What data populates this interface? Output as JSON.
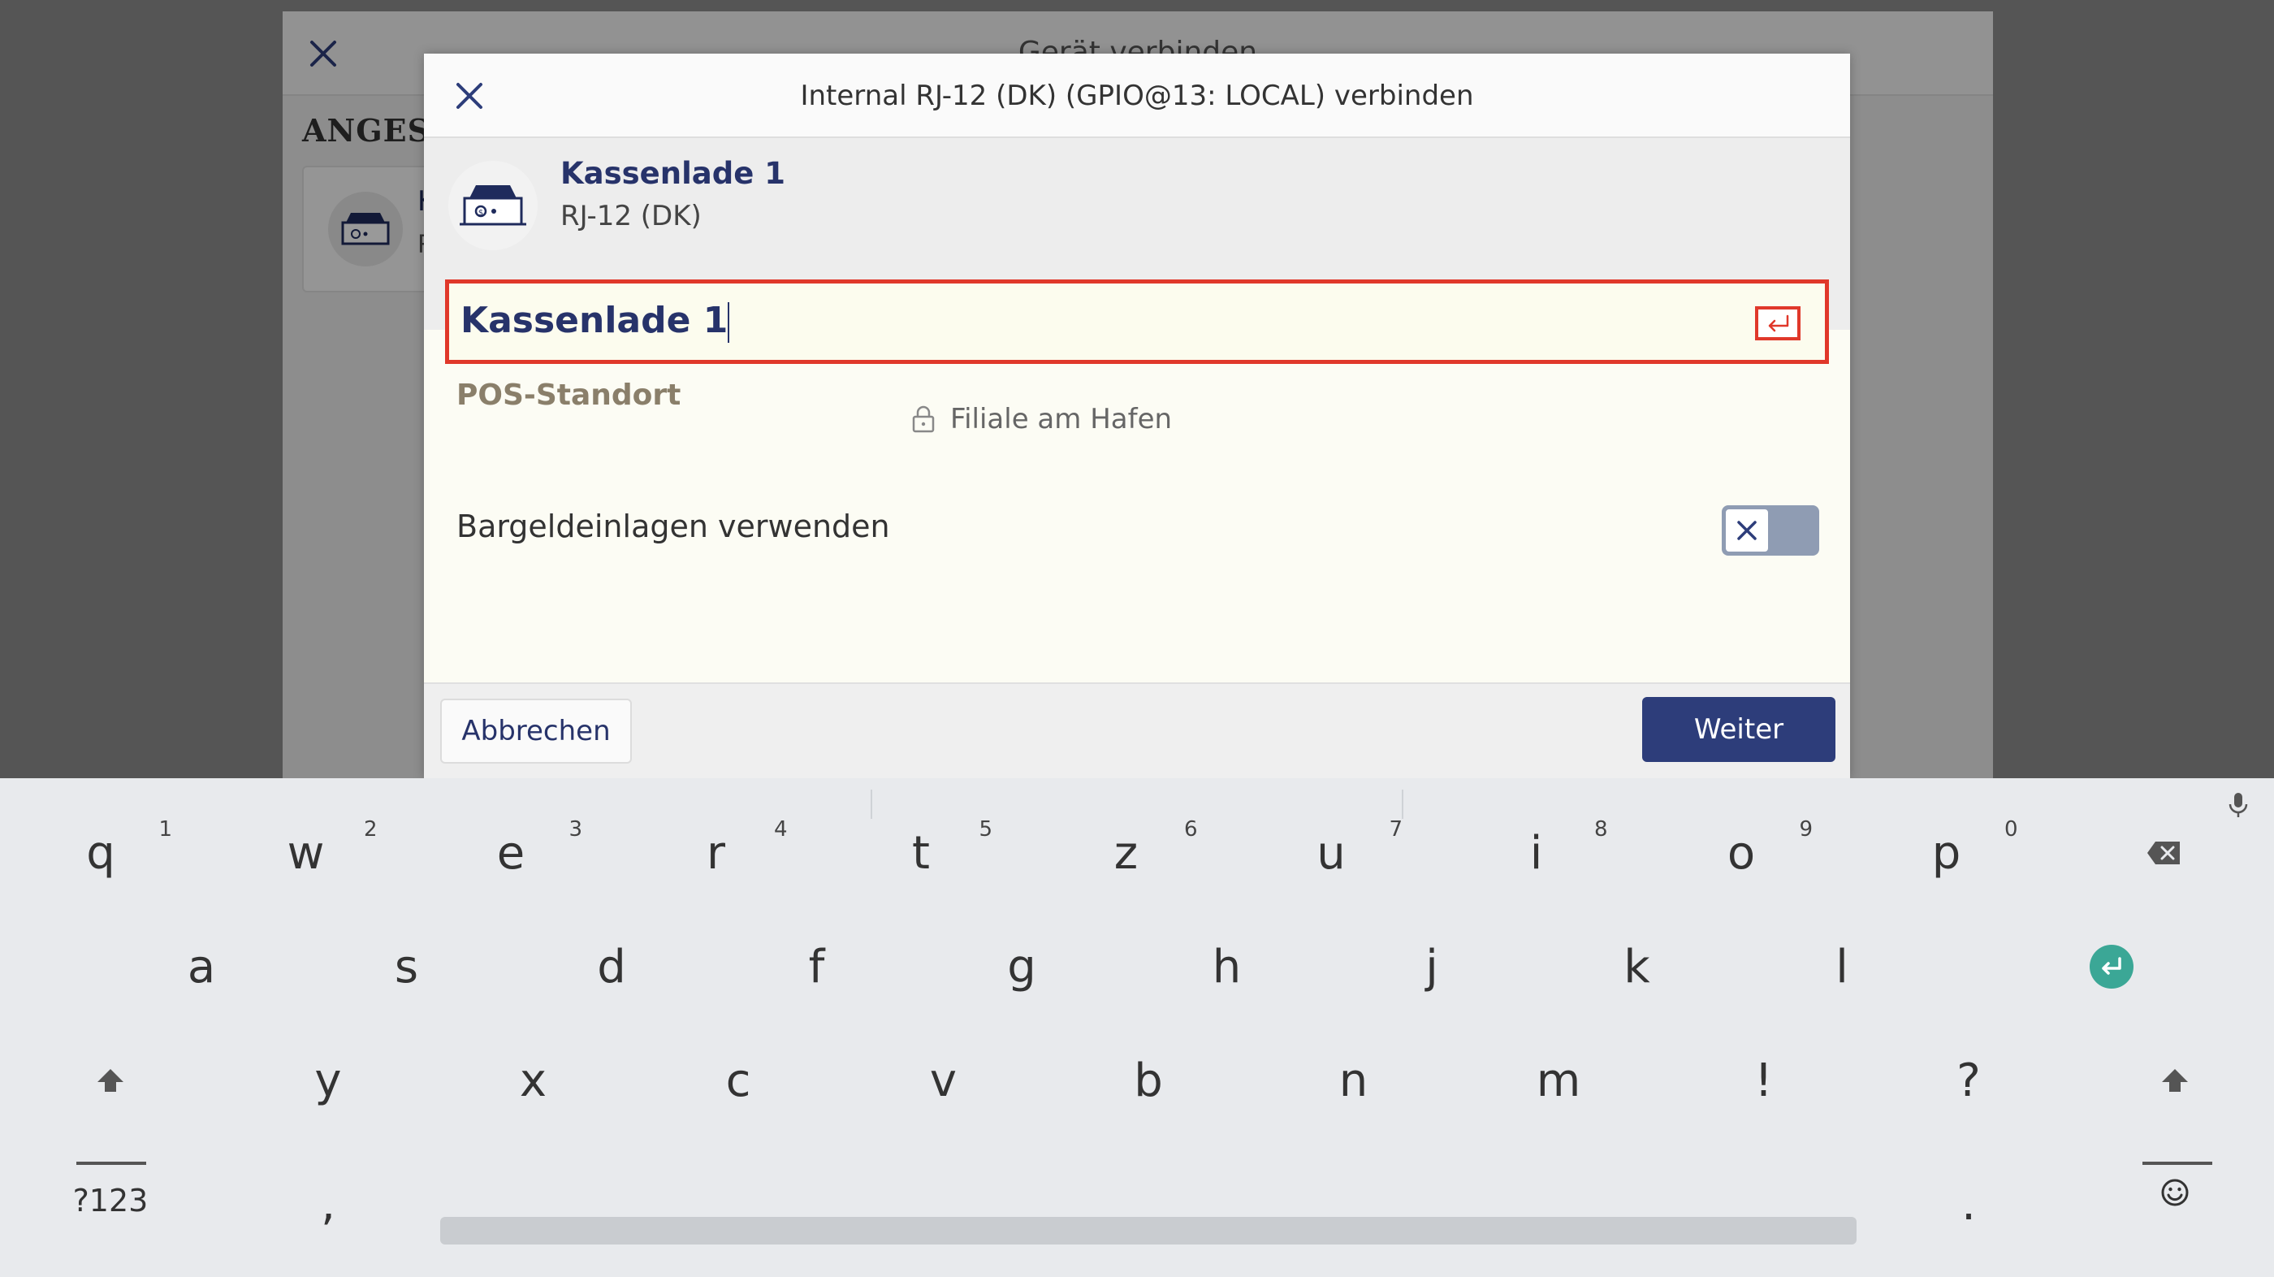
{
  "background": {
    "title": "Gerät verbinden",
    "section_label": "ANGESCHLOSSEN",
    "card_initial": "K",
    "card_sub_initial": "R"
  },
  "modal": {
    "title": "Internal RJ-12 (DK) (GPIO@13: LOCAL) verbinden",
    "device_name": "Kassenlade 1",
    "device_subtitle": "RJ-12 (DK)",
    "name_input_value": "Kassenlade 1",
    "pos_label": "POS-Standort",
    "pos_value": "Filiale am Hafen",
    "cash_label": "Bargeldeinlagen verwenden",
    "cash_enabled": false,
    "cancel_label": "Abbrechen",
    "next_label": "Weiter"
  },
  "keyboard": {
    "row1": [
      "q",
      "w",
      "e",
      "r",
      "t",
      "z",
      "u",
      "i",
      "o",
      "p"
    ],
    "row1_hints": [
      "1",
      "2",
      "3",
      "4",
      "5",
      "6",
      "7",
      "8",
      "9",
      "0"
    ],
    "row2": [
      "a",
      "s",
      "d",
      "f",
      "g",
      "h",
      "j",
      "k",
      "l"
    ],
    "row3": [
      "y",
      "x",
      "c",
      "v",
      "b",
      "n",
      "m",
      "!",
      "?"
    ],
    "symbols_label": "?123",
    "comma": ",",
    "period": ".",
    "enter_color": "#3ba796"
  },
  "colors": {
    "accent": "#2d3d7a",
    "error": "#e0382a",
    "toggle_off": "#8f9cb3"
  }
}
